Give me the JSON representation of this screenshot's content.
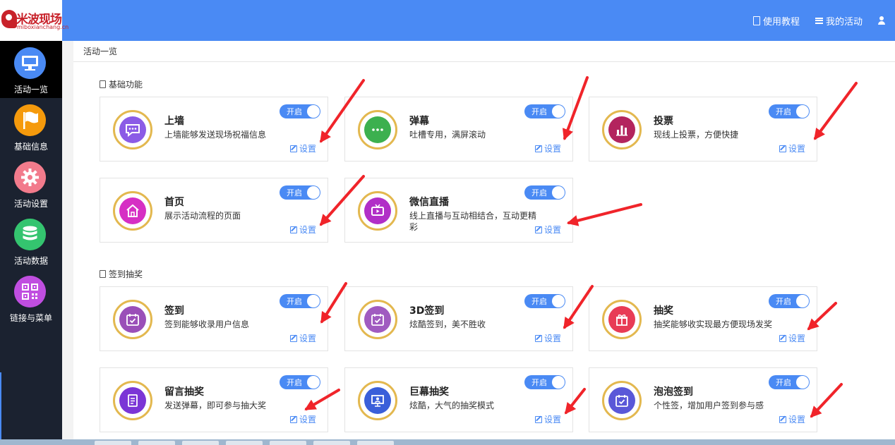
{
  "header": {
    "logo_text": "米波现场",
    "logo_sub": "miboxianchang.cn",
    "tutorial_label": "使用教程",
    "my_activity_label": "我的活动"
  },
  "sidebar": {
    "items": [
      {
        "label": "活动一览",
        "icon": "monitor-icon",
        "color": "#4a8af4"
      },
      {
        "label": "基础信息",
        "icon": "flag-icon",
        "color": "#f59a0c"
      },
      {
        "label": "活动设置",
        "icon": "gear-icon",
        "color": "#f27b8c"
      },
      {
        "label": "活动数据",
        "icon": "database-icon",
        "color": "#34c46f"
      },
      {
        "label": "链接与菜单",
        "icon": "qrcode-icon",
        "color": "#c04ee0"
      }
    ]
  },
  "breadcrumb": "活动一览",
  "sections": [
    {
      "title": "基础功能",
      "cards": [
        {
          "title": "上墙",
          "desc": "上墙能够发送现场祝福信息",
          "toggle": "开启",
          "setup": "设置",
          "icon": "chat-bubble-icon",
          "color": "#8b5be6"
        },
        {
          "title": "弹幕",
          "desc": "吐槽专用，满屏滚动",
          "toggle": "开启",
          "setup": "设置",
          "icon": "dots-icon",
          "color": "#3cb04f"
        },
        {
          "title": "投票",
          "desc": "现线上投票，方便快捷",
          "toggle": "开启",
          "setup": "设置",
          "icon": "bar-chart-icon",
          "color": "#b3245e"
        },
        {
          "title": "首页",
          "desc": "展示活动流程的页面",
          "toggle": "开启",
          "setup": "设置",
          "icon": "home-icon",
          "color": "#d62fc4"
        },
        {
          "title": "微信直播",
          "desc": "线上直播与互动相结合，互动更精彩",
          "toggle": "开启",
          "setup": "设置",
          "icon": "tv-icon",
          "color": "#b12fc7"
        }
      ]
    },
    {
      "title": "签到抽奖",
      "cards": [
        {
          "title": "签到",
          "desc": "签到能够收录用户信息",
          "toggle": "开启",
          "setup": "设置",
          "icon": "calendar-check-icon",
          "color": "#9a4fb8"
        },
        {
          "title": "3D签到",
          "desc": "炫酷签到，美不胜收",
          "toggle": "开启",
          "setup": "设置",
          "icon": "calendar-check-icon",
          "color": "#a05bc0"
        },
        {
          "title": "抽奖",
          "desc": "抽奖能够收实现最方便现场发奖",
          "toggle": "开启",
          "setup": "设置",
          "icon": "gift-icon",
          "color": "#e83b55"
        },
        {
          "title": "留言抽奖",
          "desc": "发送弹幕，即可参与抽大奖",
          "toggle": "开启",
          "setup": "设置",
          "icon": "document-icon",
          "color": "#7b35d6"
        },
        {
          "title": "巨幕抽奖",
          "desc": "炫酷，大气的抽奖模式",
          "toggle": "开启",
          "setup": "设置",
          "icon": "presentation-icon",
          "color": "#3a5fd9"
        },
        {
          "title": "泡泡签到",
          "desc": "个性签，增加用户签到参与感",
          "toggle": "开启",
          "setup": "设置",
          "icon": "calendar-check-icon",
          "color": "#5a58d8"
        }
      ]
    }
  ],
  "colors": {
    "accent": "#4a8af4",
    "sidebar_bg": "#1b2230",
    "annotation_arrow": "#f0242a"
  }
}
